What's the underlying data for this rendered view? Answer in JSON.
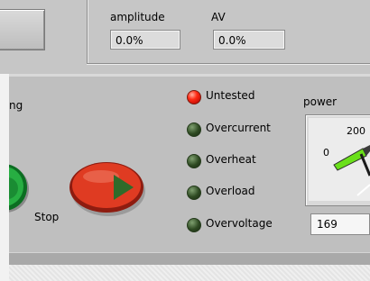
{
  "top": {
    "amplitude_label": "amplitude",
    "amplitude_value": "0.0%",
    "av_label": "AV",
    "av_value": "0.0%"
  },
  "main": {
    "left_label_fragment": "ng",
    "stop_label": "Stop"
  },
  "indicators": [
    {
      "label": "Untested",
      "state": "on"
    },
    {
      "label": "Overcurrent",
      "state": "off"
    },
    {
      "label": "Overheat",
      "state": "off"
    },
    {
      "label": "Overload",
      "state": "off"
    },
    {
      "label": "Overvoltage",
      "state": "off"
    }
  ],
  "power": {
    "label": "power",
    "tick_0": "0",
    "tick_200": "200",
    "value": "169"
  },
  "colors": {
    "panel": "#bfbfbf",
    "led_on": "#ff2a14",
    "led_off": "#2e4a22",
    "start_button": "#21a23a",
    "stop_button": "#d8341e",
    "gauge_arc": "#6ae01a"
  }
}
